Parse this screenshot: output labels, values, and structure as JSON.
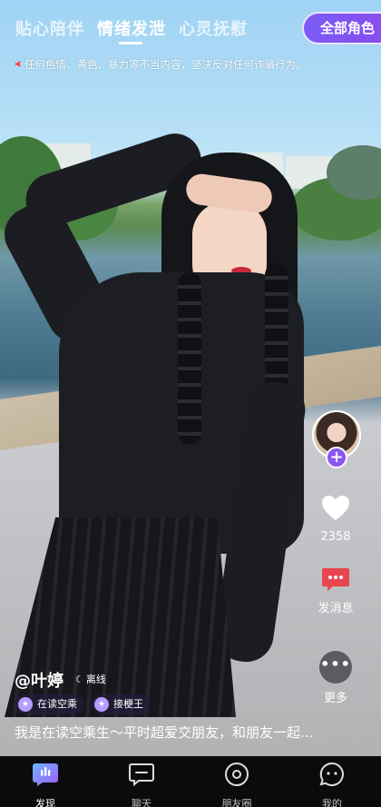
{
  "top_tabs": [
    {
      "label": "贴心陪伴",
      "active": false
    },
    {
      "label": "情绪发泄",
      "active": true
    },
    {
      "label": "心灵抚慰",
      "active": false
    }
  ],
  "all_roles_button": "全部角色",
  "notice": "任何色情、黄色、暴力等不当内容，坚决反对任何诈骗行为。",
  "icons": {
    "speaker": "speaker-icon",
    "plus": "plus-icon",
    "heart": "heart-icon",
    "message": "message-icon",
    "more": "more-icon",
    "moon": "moon-icon"
  },
  "right_rail": {
    "plus_symbol": "+",
    "like_count": "2358",
    "message_label": "发消息",
    "more_symbol": "•••",
    "more_label": "更多"
  },
  "profile": {
    "name": "@叶婷",
    "status": "离线",
    "tags": [
      "在读空乘",
      "接梗王"
    ],
    "description": "我是在读空乘生～平时超爱交朋友，和朋友一起…"
  },
  "bottom_nav": [
    {
      "label": "发现",
      "icon": "discover-icon",
      "active": true
    },
    {
      "label": "聊天",
      "icon": "chat-icon",
      "active": false
    },
    {
      "label": "朋友圈",
      "icon": "moments-icon",
      "active": false
    },
    {
      "label": "我的",
      "icon": "profile-icon",
      "active": false
    }
  ],
  "colors": {
    "accent": "#8a55f0",
    "message_red": "#e8454e",
    "nav_background": "#0b0b0d"
  }
}
